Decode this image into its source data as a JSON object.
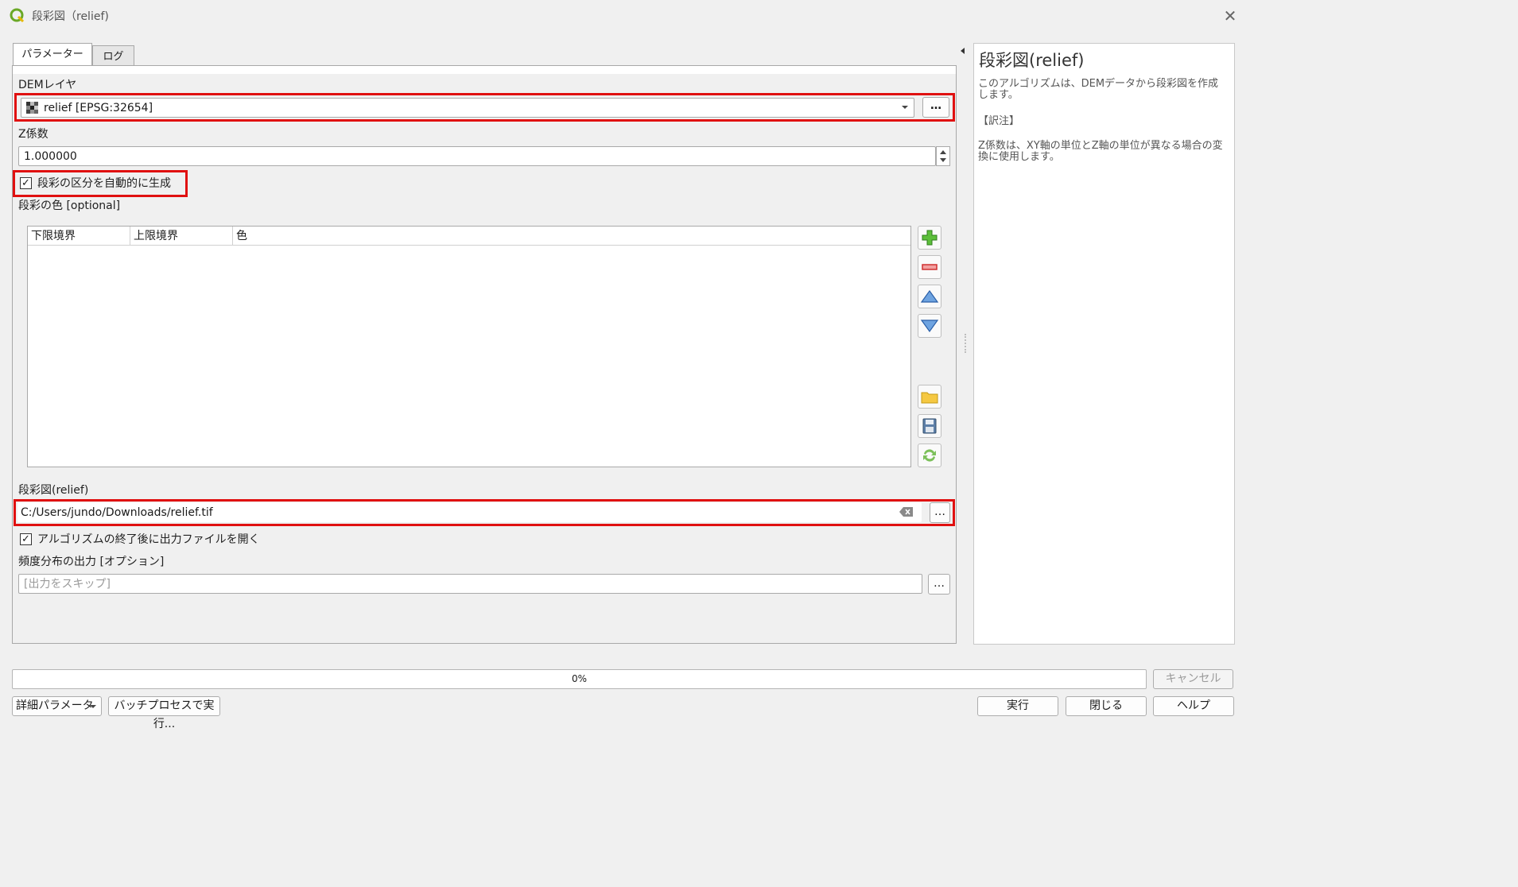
{
  "window": {
    "title": "段彩図（relief)",
    "close_glyph": "✕"
  },
  "tabs": [
    {
      "label": "パラメーター"
    },
    {
      "label": "ログ"
    }
  ],
  "params": {
    "dem_label": "DEMレイヤ",
    "dem_value": "relief [EPSG:32654]",
    "dem_more": "…",
    "z_label": "Z係数",
    "z_value": "1.000000",
    "auto_label": "段彩の区分を自動的に生成",
    "auto_checked": true,
    "colors_label": "段彩の色 [optional]",
    "table_headers": [
      "下限境界",
      "上限境界",
      "色"
    ],
    "output_label": "段彩図(relief)",
    "output_value": "C:/Users/jundo/Downloads/relief.tif",
    "output_more": "…",
    "open_after_label": "アルゴリズムの終了後に出力ファイルを開く",
    "open_after_checked": true,
    "freq_label": "頻度分布の出力 [オプション]",
    "freq_placeholder": "[出力をスキップ]",
    "freq_more": "…"
  },
  "help": {
    "title": "段彩図(relief)",
    "desc": "このアルゴリズムは、DEMデータから段彩図を作成します。",
    "note_head": "【訳注】",
    "note": "Z係数は、XY軸の単位とZ軸の単位が異なる場合の変換に使用します。"
  },
  "progress": {
    "value": 0,
    "label": "0%"
  },
  "buttons": {
    "cancel": "キャンセル",
    "advanced": "詳細パラメータ",
    "batch": "バッチプロセスで実行...",
    "run": "実行",
    "close": "閉じる",
    "help": "ヘルプ"
  },
  "colors": {
    "highlight": "#e01010",
    "add": "#3c9a2c",
    "remove": "#d03030",
    "arrow": "#3a78c8"
  }
}
